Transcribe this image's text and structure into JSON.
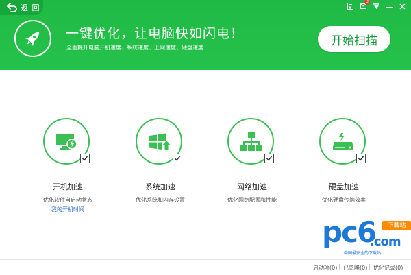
{
  "nav": {
    "back_label": "返 回",
    "back_icon": "back-arrow-icon"
  },
  "window_controls": [
    "skin-icon",
    "message-icon",
    "menu-icon",
    "minimize-icon",
    "close-icon"
  ],
  "window_badge": "3",
  "hero": {
    "icon": "rocket-icon",
    "title": "一键优化，让电脑快如闪电！",
    "subtitle": "全面提升电脑开机速度、系统速度、上网速度、硬盘速度",
    "scan_button": "开始扫描"
  },
  "features": [
    {
      "name": "开机加速",
      "desc": "优化软件自启动状态",
      "link": "我的开机时间",
      "icon": "monitor-power-icon",
      "checked": true
    },
    {
      "name": "系统加速",
      "desc": "优化系统和内存设置",
      "icon": "windows-up-icon",
      "checked": true
    },
    {
      "name": "网络加速",
      "desc": "优化网络配置和性能",
      "icon": "network-icon",
      "checked": true
    },
    {
      "name": "硬盘加速",
      "desc": "优化硬盘传输效率",
      "icon": "harddisk-icon",
      "checked": true
    }
  ],
  "watermark": {
    "big": "pc6",
    "badge": "下载站",
    "com": ".com",
    "sub": "中国最安全的下载站"
  },
  "footer": {
    "startup": "启动项(0)",
    "ignored": "已忽略(0)",
    "records": "优化记录(0)"
  },
  "colors": {
    "header_green": "#25c24b",
    "accent_green": "#3cbf55",
    "link_blue": "#2060c8"
  }
}
